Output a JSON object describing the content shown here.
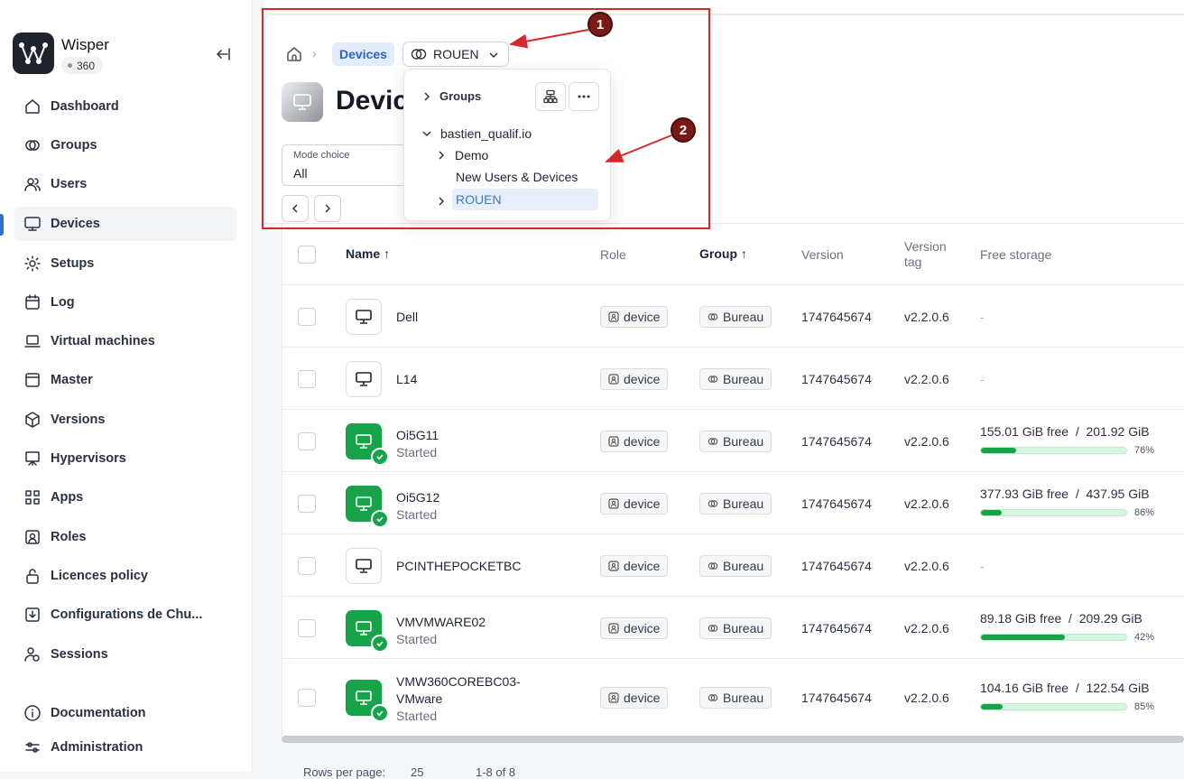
{
  "brand": {
    "name": "Wisper",
    "badge": "360"
  },
  "nav": [
    {
      "label": "Dashboard",
      "icon": "home-icon"
    },
    {
      "label": "Groups",
      "icon": "groups-icon"
    },
    {
      "label": "Users",
      "icon": "users-icon"
    },
    {
      "label": "Devices",
      "icon": "monitor-icon",
      "active": true
    },
    {
      "label": "Setups",
      "icon": "gear-icon"
    },
    {
      "label": "Log",
      "icon": "calendar-icon"
    },
    {
      "label": "Virtual machines",
      "icon": "laptop-icon"
    },
    {
      "label": "Master",
      "icon": "window-icon"
    },
    {
      "label": "Versions",
      "icon": "package-icon"
    },
    {
      "label": "Hypervisors",
      "icon": "presentation-icon"
    },
    {
      "label": "Apps",
      "icon": "apps-grid-icon"
    },
    {
      "label": "Roles",
      "icon": "id-badge-icon"
    },
    {
      "label": "Licences policy",
      "icon": "lock-icon"
    },
    {
      "label": "Configurations de Chu...",
      "icon": "download-box-icon"
    },
    {
      "label": "Sessions",
      "icon": "user-clock-icon"
    }
  ],
  "nav_bottom": [
    {
      "label": "Documentation",
      "icon": "info-icon"
    },
    {
      "label": "Administration",
      "icon": "sliders-icon"
    }
  ],
  "breadcrumb": {
    "current": "Devices",
    "group": "ROUEN"
  },
  "page": {
    "title": "Devic"
  },
  "mode": {
    "label": "Mode choice",
    "value": "All"
  },
  "dropdown": {
    "header": "Groups",
    "root": "bastien_qualif.io",
    "children": [
      {
        "label": "Demo",
        "expandable": true
      },
      {
        "label": "New Users & Devices",
        "expandable": false
      },
      {
        "label": "ROUEN",
        "expandable": true,
        "selected": true
      }
    ]
  },
  "annotations": [
    "1",
    "2"
  ],
  "table": {
    "headers": {
      "name": "Name",
      "role": "Role",
      "group": "Group",
      "version": "Version",
      "version_tag_1": "Version",
      "version_tag_2": "tag",
      "storage": "Free storage"
    },
    "rows": [
      {
        "name": "Dell",
        "status": "",
        "role": "device",
        "group": "Bureau",
        "version": "1747645674",
        "tag": "v2.2.0.6",
        "storage": "-",
        "started": false
      },
      {
        "name": "L14",
        "status": "",
        "role": "device",
        "group": "Bureau",
        "version": "1747645674",
        "tag": "v2.2.0.6",
        "storage": "-",
        "started": false
      },
      {
        "name": "Oi5G11",
        "status": "Started",
        "role": "device",
        "group": "Bureau",
        "version": "1747645674",
        "tag": "v2.2.0.6",
        "free": "155.01 GiB free",
        "total": "201.92 GiB",
        "pct": "76%",
        "fill": 0.24,
        "started": true
      },
      {
        "name": "Oi5G12",
        "status": "Started",
        "role": "device",
        "group": "Bureau",
        "version": "1747645674",
        "tag": "v2.2.0.6",
        "free": "377.93 GiB free",
        "total": "437.95 GiB",
        "pct": "86%",
        "fill": 0.14,
        "started": true
      },
      {
        "name": "PCINTHEPOCKETBC",
        "status": "",
        "role": "device",
        "group": "Bureau",
        "version": "1747645674",
        "tag": "v2.2.0.6",
        "storage": "-",
        "started": false
      },
      {
        "name": "VMVMWARE02",
        "status": "Started",
        "role": "device",
        "group": "Bureau",
        "version": "1747645674",
        "tag": "v2.2.0.6",
        "free": "89.18 GiB free",
        "total": "209.29 GiB",
        "pct": "42%",
        "fill": 0.58,
        "started": true
      },
      {
        "name": "VMW360COREBC03-",
        "name2": "VMware",
        "status": "Started",
        "role": "device",
        "group": "Bureau",
        "version": "1747645674",
        "tag": "v2.2.0.6",
        "free": "104.16 GiB free",
        "total": "122.54 GiB",
        "pct": "85%",
        "fill": 0.15,
        "started": true
      }
    ]
  },
  "footer": {
    "rows_label": "Rows per page:",
    "rows_value": "25",
    "range": "1-8 of 8"
  },
  "colors": {
    "accent": "#2f6fd6",
    "green": "#16a34a",
    "annotation": "#d62828"
  }
}
